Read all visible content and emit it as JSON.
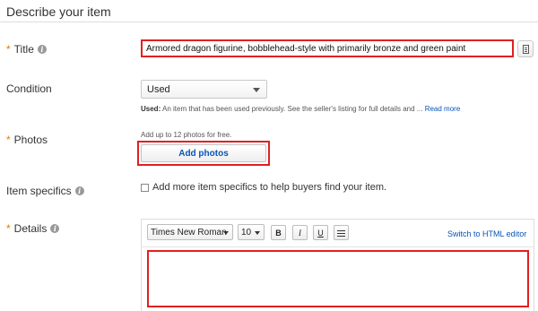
{
  "section": {
    "title": "Describe your item"
  },
  "title_field": {
    "required_mark": "*",
    "label": "Title",
    "value": "Armored dragon figurine, bobblehead-style with primarily bronze and green paint"
  },
  "condition": {
    "label": "Condition",
    "selected": "Used",
    "desc_bold": "Used:",
    "desc_text": " An item that has been used previously. See the seller's listing for full details and ...",
    "read_more": "Read more"
  },
  "photos": {
    "required_mark": "*",
    "label": "Photos",
    "hint": "Add up to 12 photos for free.",
    "button_label": "Add photos"
  },
  "item_specifics": {
    "label": "Item specifics",
    "checkbox_label": "Add more item specifics to help buyers find your item."
  },
  "details": {
    "required_mark": "*",
    "label": "Details",
    "font": "Times New Roman",
    "size": "10",
    "bold_label": "B",
    "italic_label": "I",
    "underline_label": "U",
    "html_link": "Switch to HTML editor"
  },
  "icons": {
    "info": "info-icon",
    "title_side": "document-icon",
    "list": "bulleted-list-icon"
  },
  "colors": {
    "link": "#0654ba",
    "required": "#e07a00",
    "highlight_border": "#e02020"
  }
}
